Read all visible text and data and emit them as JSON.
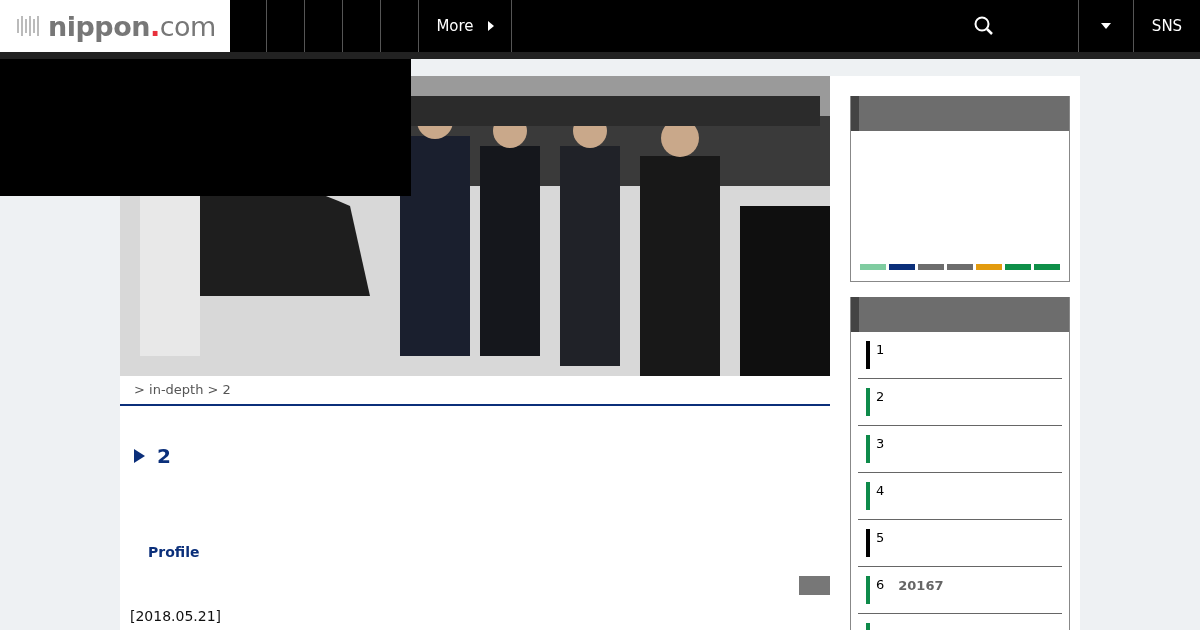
{
  "header": {
    "logo": {
      "name": "nippon",
      "dot": ".",
      "suffix": "com"
    },
    "more": "More",
    "sns": "SNS"
  },
  "breadcrumb": "> in-depth > 2",
  "heading": "2",
  "profile": "Profile",
  "date": "[2018.05.21]",
  "sidebar": {
    "color_bars": [
      {
        "color": "#7fcca0"
      },
      {
        "color": "#0b2f7a"
      },
      {
        "color": "#6d6d6d"
      },
      {
        "color": "#6d6d6d"
      },
      {
        "color": "#e39b0e"
      },
      {
        "color": "#0e8f48"
      },
      {
        "color": "#0e8f48"
      }
    ],
    "ranking": [
      {
        "number": "1",
        "color": "#000000"
      },
      {
        "number": "2",
        "color": "#0e8a4a"
      },
      {
        "number": "3",
        "color": "#0e8a4a"
      },
      {
        "number": "4",
        "color": "#0e8a4a"
      },
      {
        "number": "5",
        "color": "#000000"
      },
      {
        "number": "6",
        "title": "20167",
        "color": "#0e8a4a"
      },
      {
        "color": "#0e8a4a"
      }
    ]
  }
}
